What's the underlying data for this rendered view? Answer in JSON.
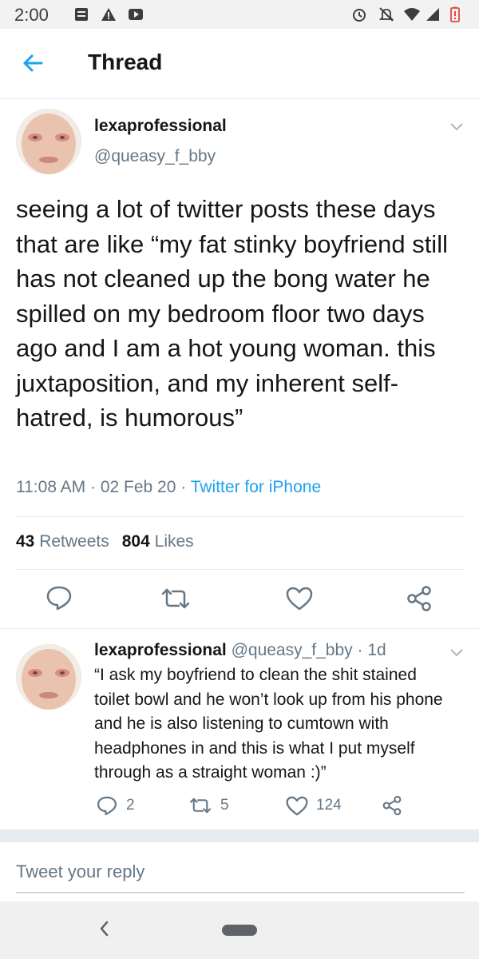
{
  "status_bar": {
    "time": "2:00",
    "icons": [
      "notes-icon",
      "alert-icon",
      "play-icon",
      "alarm-icon",
      "mute-icon",
      "wifi-icon",
      "signal-icon",
      "battery-low-icon"
    ]
  },
  "header": {
    "title": "Thread",
    "back_icon": "arrow-left-icon"
  },
  "main_tweet": {
    "display_name": "lexaprofessional",
    "handle": "@queasy_f_bby",
    "text": "seeing a lot of twitter posts these days that are like “my fat stinky boyfriend still has not cleaned up the bong water he spilled on my bedroom floor two days ago and I am a hot young woman. this juxtaposition, and my inherent self-hatred, is humorous”",
    "time": "11:08 AM",
    "date": "02 Feb 20",
    "source": "Twitter for iPhone",
    "retweets_count": "43",
    "retweets_label": "Retweets",
    "likes_count": "804",
    "likes_label": "Likes"
  },
  "reply_tweet": {
    "display_name": "lexaprofessional",
    "handle": "@queasy_f_bby",
    "age": "1d",
    "text": "“I ask my boyfriend to clean the shit stained toilet bowl and he won’t look up from his phone and he is also listening to cumtown with headphones in and this is what I put myself through as a straight woman :)”",
    "replies": "2",
    "retweets": "5",
    "likes": "124"
  },
  "compose": {
    "placeholder": "Tweet your reply"
  },
  "colors": {
    "accent": "#1da1f2",
    "text_primary": "#14171a",
    "text_secondary": "#657786",
    "divider": "#e6ecf0"
  }
}
